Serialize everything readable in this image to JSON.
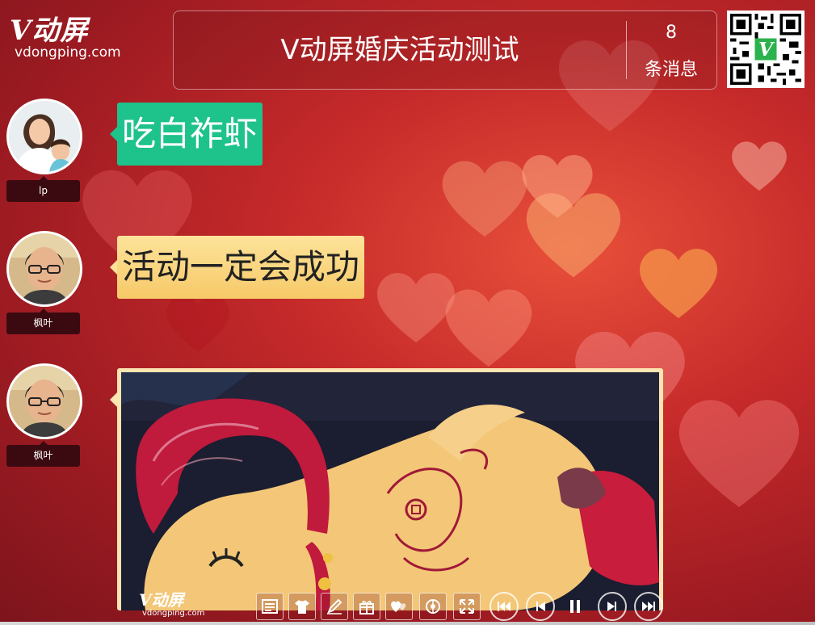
{
  "logo": {
    "brand": "V动屏",
    "domain": "vdongping.com"
  },
  "header": {
    "title": "V动屏婚庆活动测试",
    "count": "8",
    "count_label": "条消息"
  },
  "qr": {
    "icon": "qr-code-icon"
  },
  "messages": [
    {
      "author": "lp",
      "type": "text",
      "text": "吃白祚虾",
      "style": "green"
    },
    {
      "author": "枫叶",
      "type": "text",
      "text": "活动一定会成功",
      "style": "yellow"
    },
    {
      "author": "枫叶",
      "type": "image"
    }
  ],
  "toolbar": {
    "brand": "V动屏",
    "domain": "vdongping.com",
    "buttons": [
      {
        "name": "message-list",
        "icon": "list-icon"
      },
      {
        "name": "theme",
        "icon": "shirt-icon"
      },
      {
        "name": "sign",
        "icon": "pen-icon"
      },
      {
        "name": "gift",
        "icon": "gift-icon"
      },
      {
        "name": "hearts",
        "icon": "hearts-icon"
      },
      {
        "name": "lottery",
        "icon": "lottery-icon"
      },
      {
        "name": "fullscreen",
        "icon": "fullscreen-icon"
      },
      {
        "name": "first",
        "icon": "skip-first-icon"
      },
      {
        "name": "prev",
        "icon": "prev-icon"
      },
      {
        "name": "pause",
        "icon": "pause-icon"
      },
      {
        "name": "next",
        "icon": "next-icon"
      },
      {
        "name": "last",
        "icon": "skip-last-icon"
      }
    ]
  },
  "colors": {
    "bubble_green": "#1ec28b",
    "bubble_yellow": "#fde39a",
    "name_tag": "#3b0a10",
    "background": "#c62a2a"
  }
}
